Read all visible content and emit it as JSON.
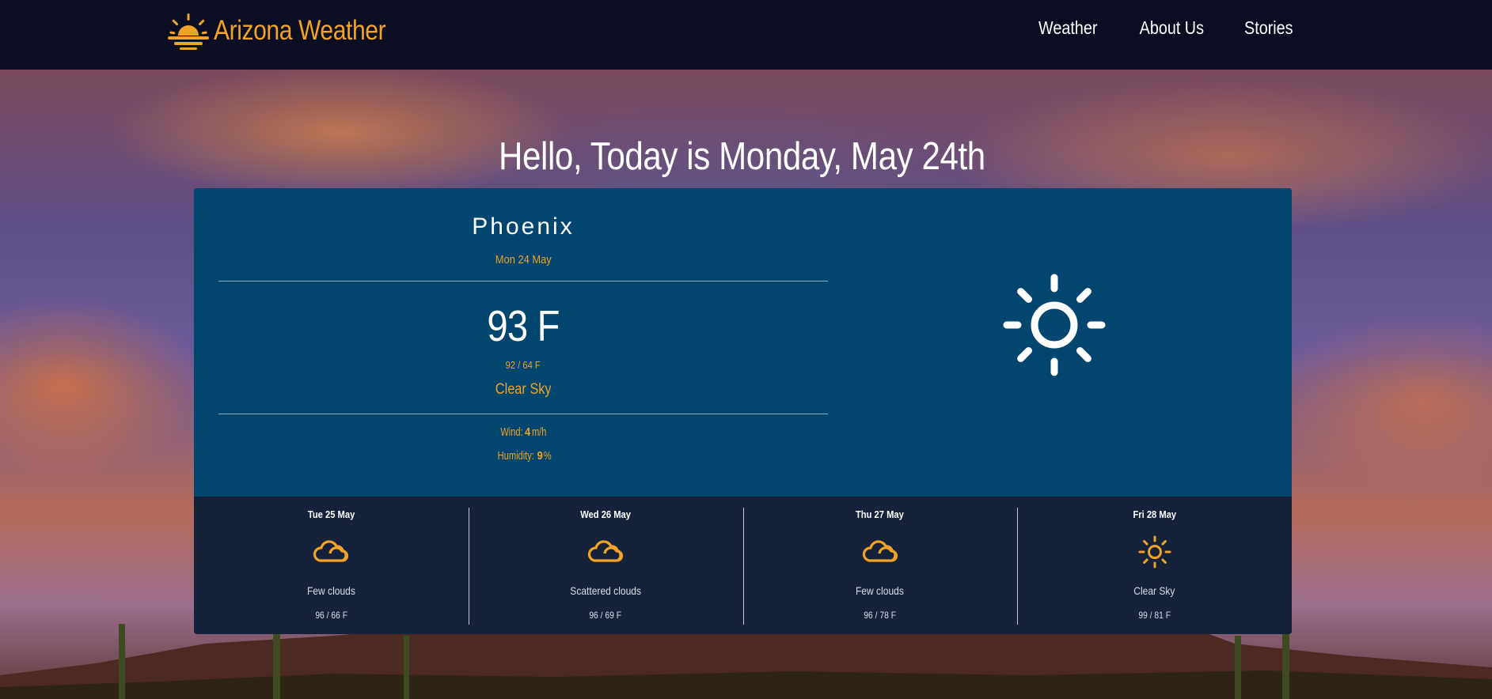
{
  "nav": {
    "brand": "Arizona Weather",
    "brand_icon": "sunrise-icon",
    "links": [
      "Weather",
      "About Us",
      "Stories"
    ]
  },
  "greeting": "Hello, Today is Monday, May 24th",
  "current": {
    "city": "Phoenix",
    "date": "Mon 24 May",
    "temperature": "93 F",
    "range": "92 / 64 F",
    "description": "Clear Sky",
    "wind_label": "Wind: ",
    "wind_value": "4",
    "wind_unit": " m/h",
    "humidity_label": "Humidity: ",
    "humidity_value": "9",
    "humidity_unit": " %",
    "icon": "sun-icon"
  },
  "forecast": [
    {
      "date": "Tue 25 May",
      "icon": "cloud-icon",
      "description": "Few clouds",
      "range": "96 / 66 F"
    },
    {
      "date": "Wed 26 May",
      "icon": "cloud-icon",
      "description": "Scattered clouds",
      "range": "96 / 69 F"
    },
    {
      "date": "Thu 27 May",
      "icon": "cloud-icon",
      "description": "Few clouds",
      "range": "96 / 78 F"
    },
    {
      "date": "Fri 28 May",
      "icon": "sun-icon",
      "description": "Clear Sky",
      "range": "99 / 81 F"
    }
  ],
  "colors": {
    "accent": "#f0a326",
    "navbar": "#0b0e22",
    "card": "#02456f",
    "forecast_bg": "#16223a"
  }
}
